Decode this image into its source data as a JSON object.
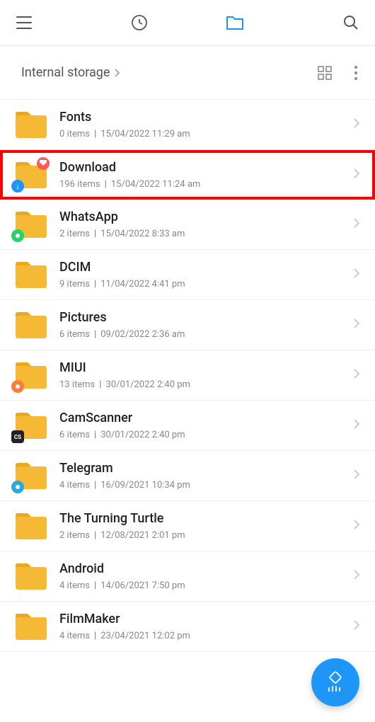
{
  "breadcrumb": {
    "title": "Internal storage"
  },
  "items": [
    {
      "name": "Fonts",
      "count": "0 items",
      "date": "15/04/2022 11:29 am",
      "highlight": false,
      "badge_tr": null,
      "badge_bl": null
    },
    {
      "name": "Download",
      "count": "196 items",
      "date": "15/04/2022 11:24 am",
      "highlight": true,
      "badge_tr": "#ff5a5a",
      "badge_bl": "#1e96f8",
      "badge_bl_glyph": "↓"
    },
    {
      "name": "WhatsApp",
      "count": "2 items",
      "date": "15/04/2022 8:33 am",
      "highlight": false,
      "badge_tr": null,
      "badge_bl": "#25d366"
    },
    {
      "name": "DCIM",
      "count": "9 items",
      "date": "11/04/2022 4:41 pm",
      "highlight": false,
      "badge_tr": null,
      "badge_bl": null
    },
    {
      "name": "Pictures",
      "count": "6 items",
      "date": "09/02/2022 2:36 am",
      "highlight": false,
      "badge_tr": null,
      "badge_bl": null
    },
    {
      "name": "MIUI",
      "count": "13 items",
      "date": "30/01/2022 2:40 pm",
      "highlight": false,
      "badge_tr": null,
      "badge_bl": "#ff7b3a"
    },
    {
      "name": "CamScanner",
      "count": "6 items",
      "date": "30/01/2022 2:40 pm",
      "highlight": false,
      "badge_tr": null,
      "badge_bl": "#222",
      "badge_bl_text": "CS"
    },
    {
      "name": "Telegram",
      "count": "4 items",
      "date": "16/09/2021 10:34 pm",
      "highlight": false,
      "badge_tr": null,
      "badge_bl": "#2aa8e0"
    },
    {
      "name": "The Turning Turtle",
      "count": "2 items",
      "date": "12/08/2021 2:01 pm",
      "highlight": false,
      "badge_tr": null,
      "badge_bl": null
    },
    {
      "name": "Android",
      "count": "4 items",
      "date": "14/06/2021 7:50 pm",
      "highlight": false,
      "badge_tr": null,
      "badge_bl": null
    },
    {
      "name": "FilmMaker",
      "count": "4 items",
      "date": "23/04/2021 12:02 pm",
      "highlight": false,
      "badge_tr": null,
      "badge_bl": null
    }
  ]
}
